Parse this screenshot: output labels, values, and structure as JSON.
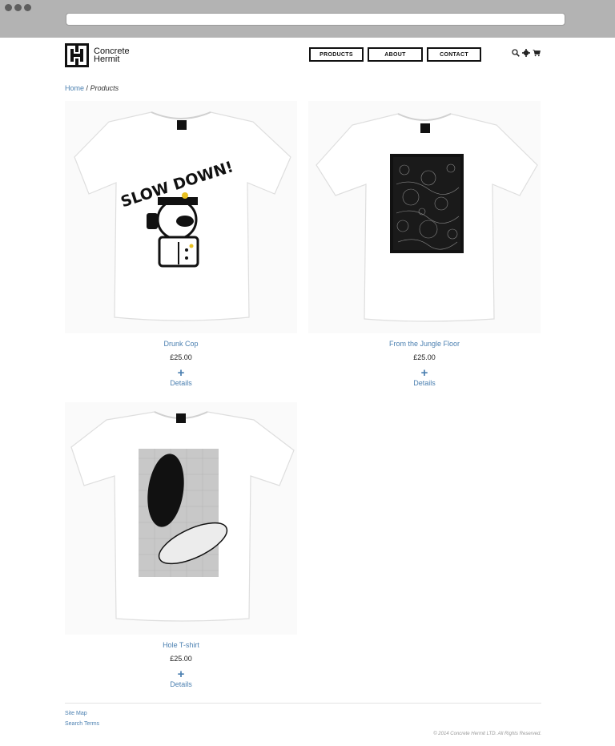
{
  "brand": {
    "name_line1": "Concrete",
    "name_line2": "Hermit"
  },
  "nav": {
    "products": "PRODUCTS",
    "about": "ABOUT",
    "contact": "CONTACT"
  },
  "tools": {
    "search": "search-icon",
    "settings": "gear-icon",
    "cart": "cart-icon"
  },
  "breadcrumb": {
    "home": "Home",
    "separator": "/",
    "current": "Products"
  },
  "products": [
    {
      "name": "Drunk Cop",
      "price": "£25.00",
      "plus": "+",
      "details": "Details",
      "graphic_text": "SLOW DOWN!"
    },
    {
      "name": "From the Jungle Floor",
      "price": "£25.00",
      "plus": "+",
      "details": "Details"
    },
    {
      "name": "Hole T-shirt",
      "price": "£25.00",
      "plus": "+",
      "details": "Details"
    }
  ],
  "footer": {
    "site_map": "Site Map",
    "search_terms": "Search Terms",
    "copyright": "© 2014 Concrete Hermit LTD. All Rights Reserved."
  },
  "colors": {
    "link": "#4a7fb0",
    "chrome": "#b3b3b3"
  }
}
